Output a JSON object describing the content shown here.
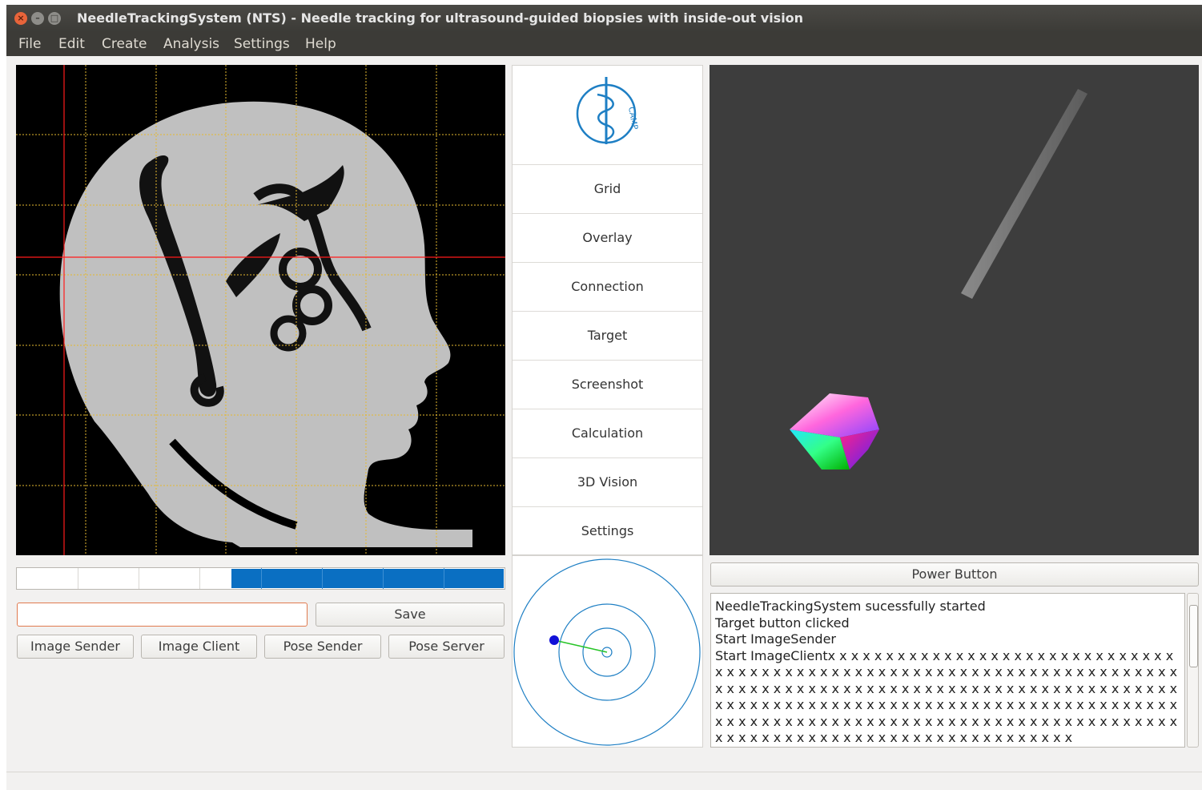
{
  "window": {
    "title": "NeedleTrackingSystem (NTS) - Needle tracking for ultrasound-guided biopsies with inside-out vision",
    "close_glyph": "×",
    "min_glyph": "–",
    "max_glyph": "□"
  },
  "menu": [
    "File",
    "Edit",
    "Create",
    "Analysis",
    "Settings",
    "Help"
  ],
  "logo": {
    "text": "CAMP",
    "brand_color": "#1e7fc4"
  },
  "nav": [
    "Grid",
    "Overlay",
    "Connection",
    "Target",
    "Screenshot",
    "Calculation",
    "3D Vision",
    "Settings"
  ],
  "progress": {
    "value": 0.56,
    "color": "#0a6fc2",
    "segments": 8
  },
  "input": {
    "value": "",
    "placeholder": ""
  },
  "buttons": {
    "save": "Save",
    "image_sender": "Image Sender",
    "image_client": "Image Client",
    "pose_sender": "Pose Sender",
    "pose_server": "Pose Server",
    "power": "Power Button"
  },
  "log": {
    "lines": [
      "NeedleTrackingSystem sucessfully started",
      "Target button clicked",
      "Start ImageSender",
      "Start ImageClientx x x x x x x x x x x x x x x x x x x x x x x x x x x x x x x x x x x x x x x x x x x x x x x x x x x x x x x x x x x x x x x x x x x x x x x x x x x x x x x x x x x x x x x x x x x x x x x x x x x x x x x x x x x x x x x x x x x x x x x x x x x x x x x x x x x x x x x x x x x x x x x x x x x x x x x x x x x x x x x x x x x x x x x x x x x x x x x x x x x x x x x x x x x x x x x x x x x x x x x x x x x x x x x x x x x x x x x x x x x x x"
    ]
  },
  "image_view": {
    "crosshair_color": "#ff1a1a",
    "grid_color": "#e5b830"
  },
  "colors": {
    "accent_orange": "#e07a4f",
    "panel_dark": "#3d3d3d",
    "target_circle": "#1e7fc4",
    "target_line": "#27c427",
    "target_dot": "#1010d8"
  }
}
